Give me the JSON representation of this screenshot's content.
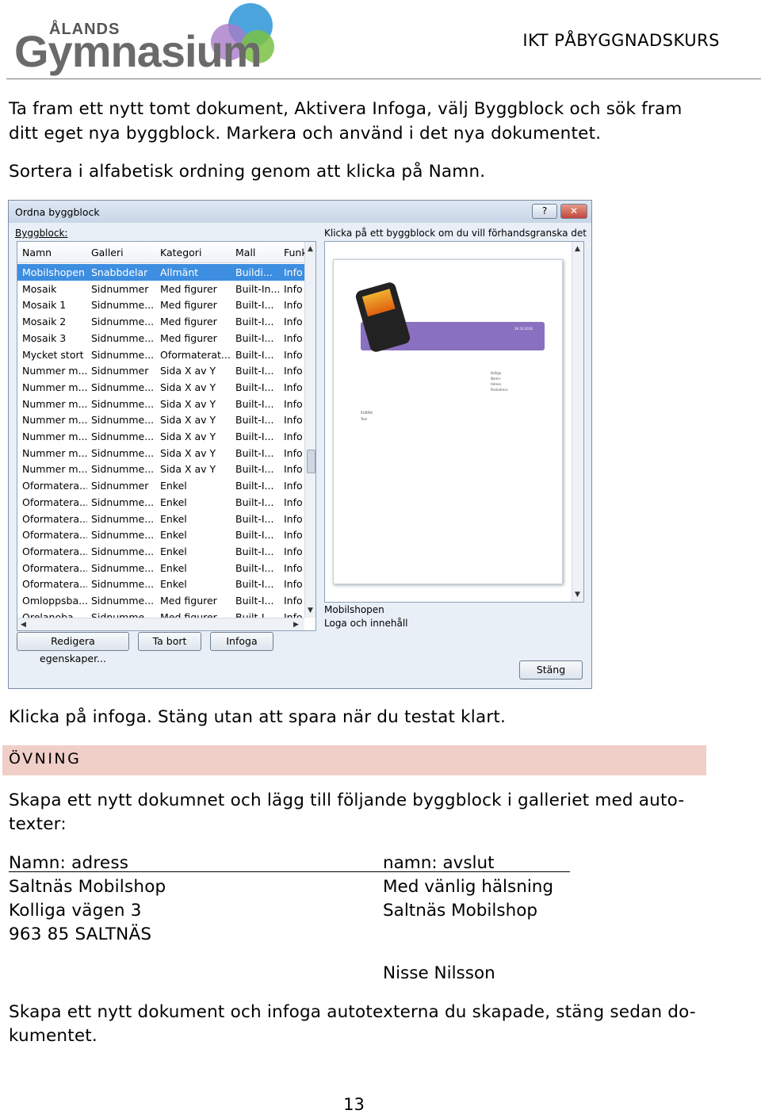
{
  "header": {
    "logo_small": "ÅLANDS",
    "logo_big": "Gymnasium",
    "course": "IKT PÅBYGGNADSKURS"
  },
  "intro": {
    "line1": "Ta fram ett nytt tomt dokument, Aktivera Infoga, välj Byggblock och sök fram",
    "line2": "ditt eget nya byggblock. Markera och använd i det nya dokumentet.",
    "line3": "Sortera i alfabetisk ordning genom att klicka på Namn."
  },
  "dialog": {
    "title": "Ordna byggblock",
    "help": "?",
    "close": "✕",
    "list_label": "Byggblock:",
    "preview_label": "Klicka på ett byggblock om du vill förhandsgranska det",
    "columns": [
      "Namn",
      "Galleri",
      "Kategori",
      "Mall",
      "Funk"
    ],
    "rows": [
      [
        "Mobilshopen",
        "Snabbdelar",
        "Allmänt",
        "Buildi...",
        "Info"
      ],
      [
        "Mosaik",
        "Sidnummer",
        "Med figurer",
        "Built-In...",
        "Info"
      ],
      [
        "Mosaik 1",
        "Sidnumme...",
        "Med figurer",
        "Built-I...",
        "Info"
      ],
      [
        "Mosaik 2",
        "Sidnumme...",
        "Med figurer",
        "Built-I...",
        "Info"
      ],
      [
        "Mosaik 3",
        "Sidnumme...",
        "Med figurer",
        "Built-I...",
        "Info"
      ],
      [
        "Mycket stort",
        "Sidnumme...",
        "Oformaterat...",
        "Built-I...",
        "Info"
      ],
      [
        "Nummer m...",
        "Sidnummer",
        "Sida X av Y",
        "Built-I...",
        "Info"
      ],
      [
        "Nummer m...",
        "Sidnumme...",
        "Sida X av Y",
        "Built-I...",
        "Info"
      ],
      [
        "Nummer m...",
        "Sidnumme...",
        "Sida X av Y",
        "Built-I...",
        "Info"
      ],
      [
        "Nummer m...",
        "Sidnumme...",
        "Sida X av Y",
        "Built-I...",
        "Info"
      ],
      [
        "Nummer m...",
        "Sidnumme...",
        "Sida X av Y",
        "Built-I...",
        "Info"
      ],
      [
        "Nummer m...",
        "Sidnumme...",
        "Sida X av Y",
        "Built-I...",
        "Info"
      ],
      [
        "Nummer m...",
        "Sidnumme...",
        "Sida X av Y",
        "Built-I...",
        "Info"
      ],
      [
        "Oformatera...",
        "Sidnummer",
        "Enkel",
        "Built-I...",
        "Info"
      ],
      [
        "Oformatera...",
        "Sidnumme...",
        "Enkel",
        "Built-I...",
        "Info"
      ],
      [
        "Oformatera...",
        "Sidnumme...",
        "Enkel",
        "Built-I...",
        "Info"
      ],
      [
        "Oformatera...",
        "Sidnumme...",
        "Enkel",
        "Built-I...",
        "Info"
      ],
      [
        "Oformatera...",
        "Sidnumme...",
        "Enkel",
        "Built-I...",
        "Info"
      ],
      [
        "Oformatera...",
        "Sidnumme...",
        "Enkel",
        "Built-I...",
        "Info"
      ],
      [
        "Oformatera...",
        "Sidnumme...",
        "Enkel",
        "Built-I...",
        "Info"
      ],
      [
        "Omloppsba...",
        "Sidnumme...",
        "Med figurer",
        "Built-I...",
        "Info"
      ],
      [
        "Orelanoba...",
        "Sidnumme...",
        "Med figurer",
        "Built-I...",
        "Info"
      ]
    ],
    "buttons": {
      "edit": "Redigera egenskaper...",
      "delete": "Ta bort",
      "insert": "Infoga",
      "close": "Stäng"
    },
    "preview_name": "Mobilshopen",
    "preview_desc": "Loga och innehåll",
    "preview_date": "28.10.2016",
    "preview_lines": [
      "Kolliga",
      "Namn:",
      "Adress",
      "Postadress"
    ],
    "preview_rubrik": "RUBRIK",
    "preview_text": "Text"
  },
  "after_dialog": "Klicka på infoga. Stäng utan att spara när du testat klart.",
  "exercise": {
    "heading": "ÖVNING",
    "line1": "Skapa ett nytt dokumnet och lägg till följande byggblock i galleriet med auto-",
    "line2": "texter:",
    "left": [
      "Namn: adress",
      "Saltnäs Mobilshop",
      "Kolliga vägen 3",
      "963 85 SALTNÄS"
    ],
    "right": [
      "namn: avslut",
      "Med vänlig hälsning",
      "Saltnäs Mobilshop",
      "Nisse Nilsson"
    ],
    "final1": "Skapa ett nytt dokument och infoga autotexterna du skapade, stäng sedan do-",
    "final2": "kumentet."
  },
  "page_number": "13",
  "colors": {
    "ovning_bg": "#f0cfc8",
    "selected_row": "#3d8ee0",
    "preview_band": "#8a70c0"
  }
}
